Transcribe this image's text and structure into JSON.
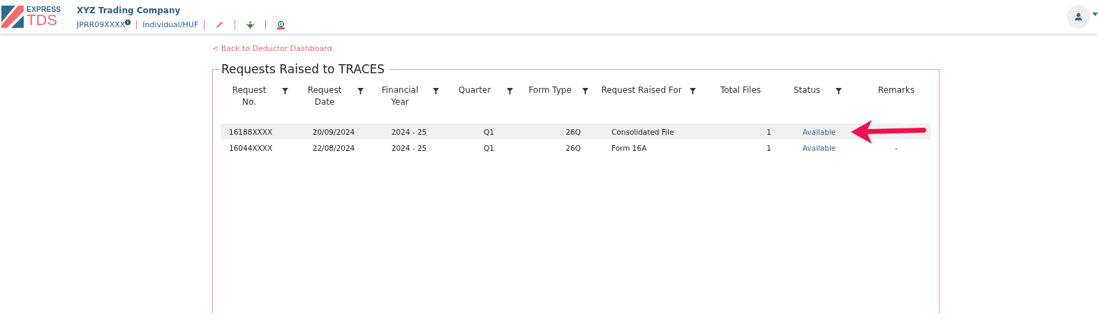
{
  "header": {
    "logo": {
      "top": "EXPRESS",
      "bottom": "TDS"
    },
    "company": "XYZ Trading Company",
    "tan": "JPRR09XXXX",
    "category": "Individual/HUF"
  },
  "back_link": "< Back to Deductor Dashboard",
  "section": {
    "title": "Requests Raised to TRACES"
  },
  "table": {
    "columns": [
      {
        "label": "Request No.",
        "filterable": true
      },
      {
        "label": "Request Date",
        "filterable": true
      },
      {
        "label": "Financial Year",
        "filterable": true
      },
      {
        "label": "Quarter",
        "filterable": true
      },
      {
        "label": "Form Type",
        "filterable": true
      },
      {
        "label": "Request Raised For",
        "filterable": true
      },
      {
        "label": "Total Files",
        "filterable": false
      },
      {
        "label": "Status",
        "filterable": true
      },
      {
        "label": "Remarks",
        "filterable": false
      }
    ],
    "rows": [
      {
        "selected": true,
        "cells": [
          "16188XXXX",
          "20/09/2024",
          "2024 - 25",
          "Q1",
          "26Q",
          "Consolidated File",
          "1",
          "Available"
        ]
      },
      {
        "selected": false,
        "cells": [
          "16044XXXX",
          "22/08/2024",
          "2024 - 25",
          "Q1",
          "26Q",
          "Form 16A",
          "1",
          "Available",
          "-"
        ]
      }
    ]
  }
}
